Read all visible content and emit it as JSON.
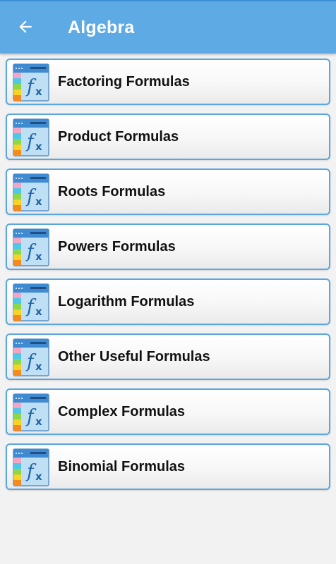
{
  "app_bar": {
    "title": "Algebra",
    "back_icon": "arrow-left-icon",
    "background": "#5eaae5"
  },
  "list": {
    "item_icon": "function-fx-icon",
    "border_color": "#5aa6e0",
    "items": [
      {
        "label": "Factoring Formulas"
      },
      {
        "label": "Product Formulas"
      },
      {
        "label": "Roots Formulas"
      },
      {
        "label": "Powers Formulas"
      },
      {
        "label": "Logarithm Formulas"
      },
      {
        "label": "Other Useful Formulas"
      },
      {
        "label": "Complex Formulas"
      },
      {
        "label": "Binomial Formulas"
      }
    ]
  }
}
